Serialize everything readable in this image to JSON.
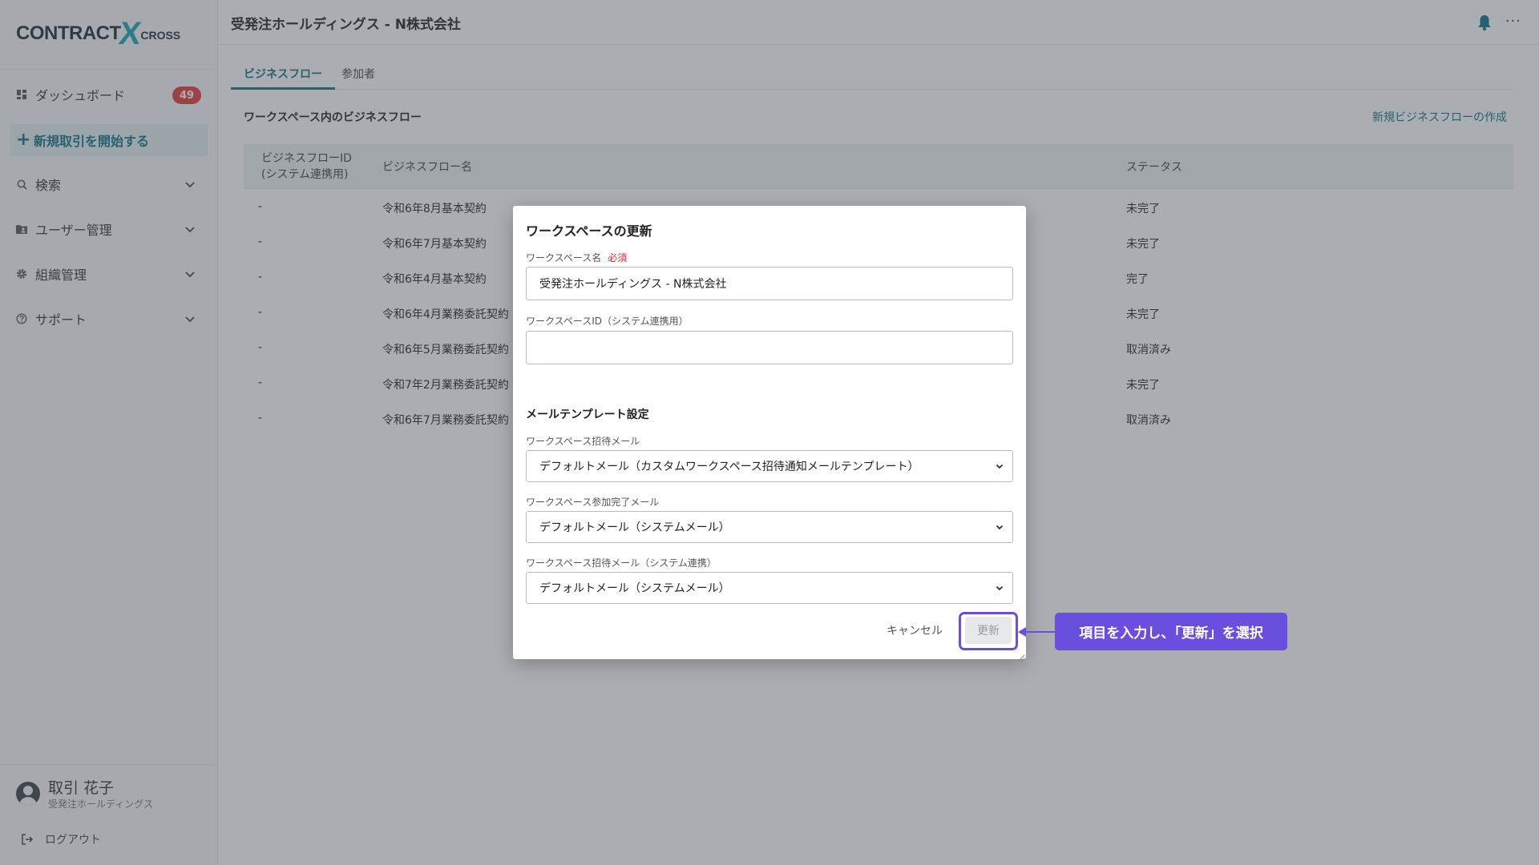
{
  "app": {
    "logo_main": "CONTRACT",
    "logo_x": "X",
    "logo_sub": "CROSS"
  },
  "sidebar": {
    "items": [
      {
        "label": "ダッシュボード",
        "icon": "dashboard-icon",
        "badge": "49"
      },
      {
        "label": "新規取引を開始する",
        "icon": "plus-icon"
      },
      {
        "label": "検索",
        "icon": "search-icon"
      },
      {
        "label": "ユーザー管理",
        "icon": "folder-user-icon"
      },
      {
        "label": "組織管理",
        "icon": "gear-icon"
      },
      {
        "label": "サポート",
        "icon": "help-circle-icon"
      }
    ],
    "user": {
      "name": "取引 花子",
      "org": "受発注ホールディングス"
    },
    "logout": "ログアウト"
  },
  "header": {
    "title": "受発注ホールディングス - N株式会社",
    "more": "···"
  },
  "tabs": [
    {
      "label": "ビジネスフロー",
      "active": true
    },
    {
      "label": "参加者",
      "active": false
    }
  ],
  "section": {
    "title": "ワークスペース内のビジネスフロー",
    "create_link": "新規ビジネスフローの作成"
  },
  "table": {
    "headers": {
      "id_line1": "ビジネスフローID",
      "id_line2": "(システム連携用)",
      "name": "ビジネスフロー名",
      "status": "ステータス"
    },
    "rows": [
      {
        "id": "-",
        "name": "令和6年8月基本契約",
        "status": "未完了"
      },
      {
        "id": "-",
        "name": "令和6年7月基本契約",
        "status": "未完了"
      },
      {
        "id": "-",
        "name": "令和6年4月基本契約",
        "status": "完了"
      },
      {
        "id": "-",
        "name": "令和6年4月業務委託契約",
        "status": "未完了"
      },
      {
        "id": "-",
        "name": "令和6年5月業務委託契約",
        "status": "取消済み"
      },
      {
        "id": "-",
        "name": "令和7年2月業務委託契約",
        "status": "未完了"
      },
      {
        "id": "-",
        "name": "令和6年7月業務委託契約",
        "status": "取消済み"
      }
    ]
  },
  "modal": {
    "title": "ワークスペースの更新",
    "name_label": "ワークスペース名",
    "required": "必須",
    "name_value": "受発注ホールディングス - N株式会社",
    "id_label": "ワークスペースID（システム連携用）",
    "id_value": "",
    "mail_section": "メールテンプレート設定",
    "invite_label": "ワークスペース招待メール",
    "invite_value": "デフォルトメール（カスタムワークスペース招待通知メールテンプレート）",
    "join_label": "ワークスペース参加完了メール",
    "join_value": "デフォルトメール（システムメール）",
    "invite_sys_label": "ワークスペース招待メール（システム連携）",
    "invite_sys_value": "デフォルトメール（システムメール）",
    "cancel": "キャンセル",
    "update": "更新"
  },
  "callout": {
    "text": "項目を入力し、「更新」を選択"
  },
  "colors": {
    "accent": "#0d6f86",
    "brand_x": "#14a7b5",
    "badge": "#e53935",
    "required": "#d32f2f",
    "callout": "#6a4ee0"
  }
}
